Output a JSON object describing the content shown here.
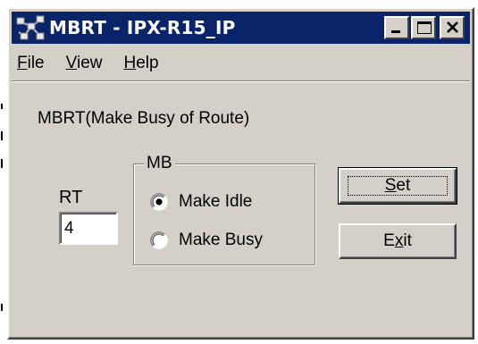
{
  "window": {
    "title": "MBRT - IPX-R15_IP",
    "app_icon": "network-nodes-icon",
    "controls": [
      "minimize-icon",
      "maximize-icon",
      "close-icon"
    ]
  },
  "menu": {
    "items": [
      {
        "label": "File",
        "mnemonic": "F",
        "rest": "ile"
      },
      {
        "label": "View",
        "mnemonic": "V",
        "rest": "iew"
      },
      {
        "label": "Help",
        "mnemonic": "H",
        "rest": "elp"
      }
    ]
  },
  "form": {
    "heading": "MBRT(Make Busy of Route)",
    "rt_label": "RT",
    "rt_value": "4",
    "group_label": "MB",
    "radios": [
      {
        "label": "Make Idle",
        "checked": true
      },
      {
        "label": "Make Busy",
        "checked": false
      }
    ]
  },
  "buttons": {
    "set": {
      "label": "Set",
      "mnemonic": "S",
      "rest": "et"
    },
    "exit": {
      "label": "Exit",
      "pre": "E",
      "mnemonic": "x",
      "rest": "it"
    }
  },
  "colors": {
    "titlebar": "#0a246a",
    "face": "#d4d0c8"
  }
}
